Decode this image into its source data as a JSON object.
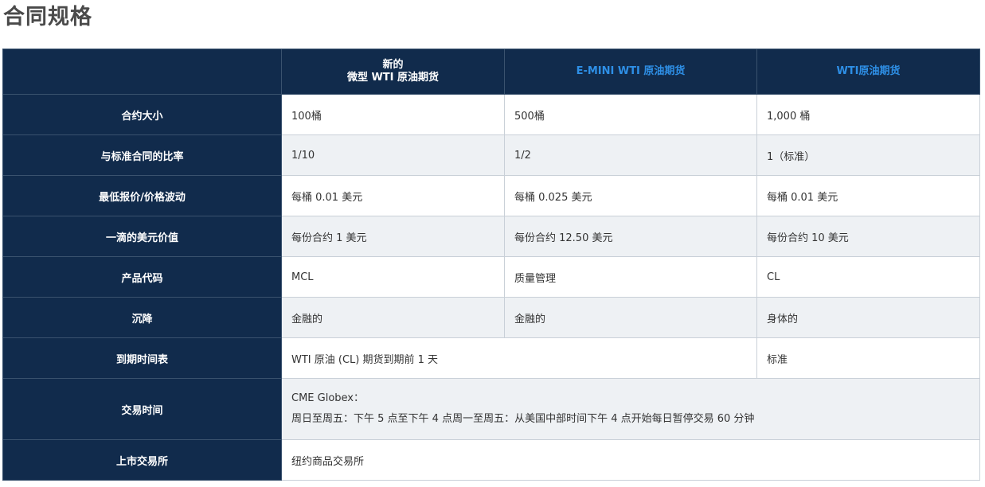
{
  "page": {
    "title": "合同规格"
  },
  "table": {
    "header": {
      "corner": "",
      "col1_line1": "新的",
      "col1_line2": "微型 WTI 原油期货",
      "col2": "E-MINI WTI 原油期货",
      "col3": "WTI原油期货"
    },
    "rows": [
      {
        "label": "合约大小",
        "c1": "100桶",
        "c2": "500桶",
        "c3": "1,000 桶"
      },
      {
        "label": "与标准合同的比率",
        "c1": "1/10",
        "c2": "1/2",
        "c3": "1（标准）"
      },
      {
        "label": "最低报价/价格波动",
        "c1": "每桶 0.01 美元",
        "c2": "每桶 0.025 美元",
        "c3": "每桶 0.01 美元"
      },
      {
        "label": "一滴的美元价值",
        "c1": "每份合约 1 美元",
        "c2": "每份合约 12.50 美元",
        "c3": "每份合约 10 美元"
      },
      {
        "label": "产品代码",
        "c1": "MCL",
        "c2": "质量管理",
        "c3": "CL"
      },
      {
        "label": "沉降",
        "c1": "金融的",
        "c2": "金融的",
        "c3": "身体的"
      },
      {
        "label": "到期时间表",
        "c12": "WTI 原油 (CL) 期货到期前 1 天",
        "c3": "标准"
      },
      {
        "label": "交易时间",
        "line1": "CME Globex：",
        "line2": "周日至周五：下午 5 点至下午 4 点周一至周五：从美国中部时间下午 4 点开始每日暂停交易 60 分钟"
      },
      {
        "label": "上市交易所",
        "value": "纽约商品交易所"
      }
    ]
  }
}
